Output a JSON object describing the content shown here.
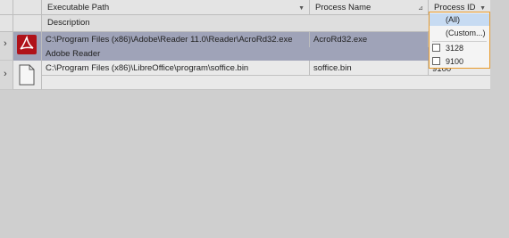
{
  "columns": {
    "executable_path": "Executable Path",
    "process_name": "Process Name",
    "process_id": "Process ID",
    "description": "Description"
  },
  "rows": [
    {
      "expander": "›",
      "icon": "adobe-reader-icon",
      "path": "C:\\Program Files (x86)\\Adobe\\Reader 11.0\\Reader\\AcroRd32.exe",
      "name": "AcroRd32.exe",
      "description": "Adobe Reader",
      "selected": true
    },
    {
      "expander": "›",
      "icon": "document-icon",
      "path": "C:\\Program Files (x86)\\LibreOffice\\program\\soffice.bin",
      "name": "soffice.bin",
      "pid_partial": "9100",
      "selected": false
    }
  ],
  "filter_dropdown": {
    "items": [
      "(All)",
      "(Custom...)"
    ],
    "checkbox_items": [
      "3128",
      "9100"
    ]
  },
  "colors": {
    "selected_row": "#9fa3b8",
    "dropdown_border": "#e89a2a",
    "adobe_red": "#b0121a"
  }
}
